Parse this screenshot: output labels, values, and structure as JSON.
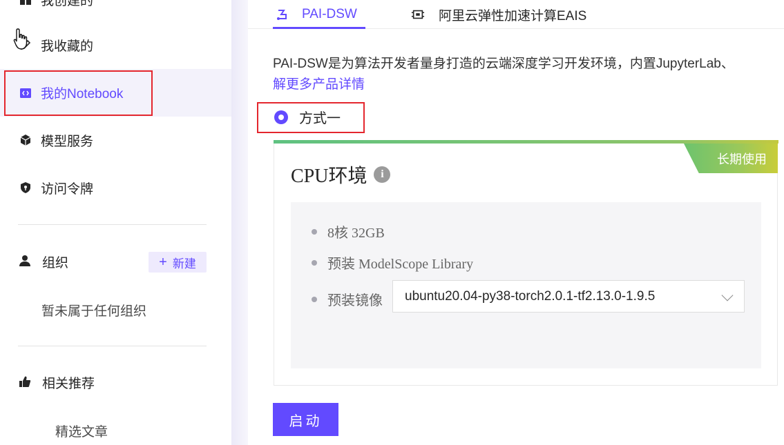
{
  "sidebar": {
    "top_cut_label": "我创建的",
    "items": [
      {
        "label": "我收藏的",
        "icon": "pen-icon"
      },
      {
        "label": "我的Notebook",
        "icon": "notebook-icon",
        "active": true
      },
      {
        "label": "模型服务",
        "icon": "cube-icon"
      },
      {
        "label": "访问令牌",
        "icon": "shield-key-icon"
      }
    ],
    "org": {
      "label": "组织",
      "new_button": "新建",
      "empty_text": "暂未属于任何组织"
    },
    "recommend": {
      "label": "相关推荐",
      "sub_item": "精选文章"
    }
  },
  "tabs": [
    {
      "label": "PAI-DSW",
      "icon": "pai-dsw-icon",
      "active": true
    },
    {
      "label": "阿里云弹性加速计算EAIS",
      "icon": "eais-chip-icon",
      "active": false
    }
  ],
  "description": "PAI-DSW是为算法开发者量身打造的云端深度学习开发环境，内置JupyterLab、",
  "description_link": "解更多产品详情",
  "option": {
    "label": "方式一",
    "selected": true
  },
  "card": {
    "badge": "长期使用",
    "title": "CPU环境",
    "specs": [
      "8核 32GB",
      "预装 ModelScope Library"
    ],
    "image_label": "预装镜像",
    "image_value": "ubuntu20.04-py38-torch2.0.1-tf2.13.0-1.9.5"
  },
  "start_button": "启动",
  "colors": {
    "accent": "#624aff",
    "highlight_box": "#e4262d",
    "badge_green": "#6dc36e",
    "badge_yellow": "#c9cd3a"
  }
}
